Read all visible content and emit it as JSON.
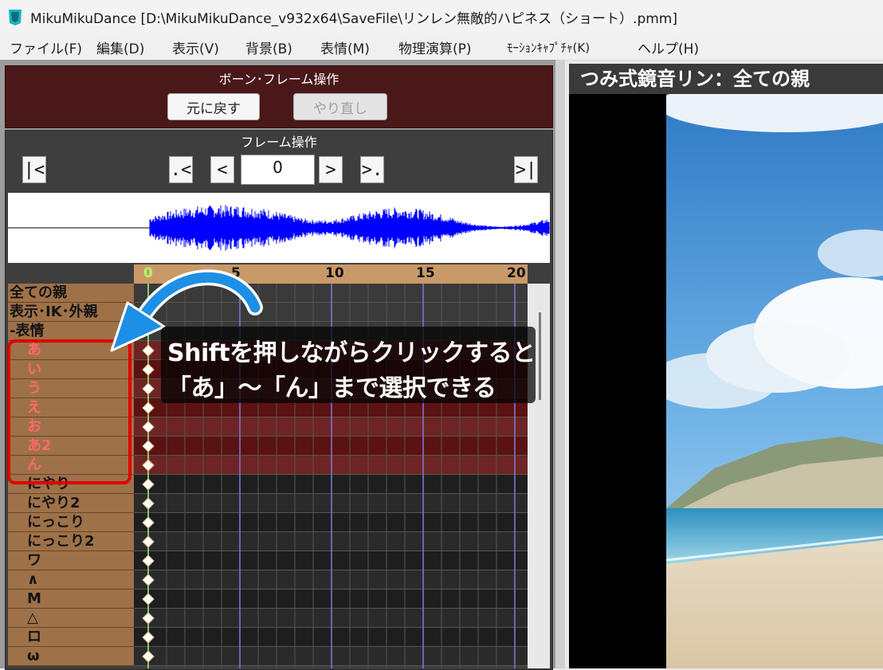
{
  "window": {
    "title": "MikuMikuDance [D:\\MikuMikuDance_v932x64\\SaveFile\\リンレン無敵的ハピネス（ショート）.pmm]"
  },
  "menu": [
    "ファイル(F)",
    "編集(D)",
    "表示(V)",
    "背景(B)",
    "表情(M)",
    "物理演算(P)",
    "ﾓｰｼｮﾝｷｬﾌﾟﾁｬ(K)",
    "ヘルプ(H)"
  ],
  "bone_frame": {
    "title": "ボーン･フレーム操作",
    "undo": "元に戻す",
    "redo": "やり直し"
  },
  "frame_ops": {
    "title": "フレーム操作",
    "first": "|<",
    "prev_key": ".<",
    "prev": "<",
    "frame_value": "0",
    "next": ">",
    "next_key": ">.",
    "last": ">|"
  },
  "timeline": {
    "ticks": [
      "0",
      "5",
      "10",
      "15",
      "20"
    ],
    "rows": [
      {
        "label": "全ての親",
        "kind": "group"
      },
      {
        "label": "表示･IK･外親",
        "kind": "group"
      },
      {
        "label": "-表情",
        "kind": "group"
      },
      {
        "label": "あ",
        "kind": "morph"
      },
      {
        "label": "い",
        "kind": "morph"
      },
      {
        "label": "う",
        "kind": "morph"
      },
      {
        "label": "え",
        "kind": "morph"
      },
      {
        "label": "お",
        "kind": "morph"
      },
      {
        "label": "あ2",
        "kind": "morph"
      },
      {
        "label": "ん",
        "kind": "morph"
      },
      {
        "label": "にやり",
        "kind": "normal"
      },
      {
        "label": "にやり2",
        "kind": "normal"
      },
      {
        "label": "にっこり",
        "kind": "normal"
      },
      {
        "label": "にっこり2",
        "kind": "normal"
      },
      {
        "label": "ワ",
        "kind": "normal"
      },
      {
        "label": "∧",
        "kind": "normal"
      },
      {
        "label": "M",
        "kind": "normal"
      },
      {
        "label": "△",
        "kind": "normal"
      },
      {
        "label": "ロ",
        "kind": "normal"
      },
      {
        "label": "ω",
        "kind": "normal"
      }
    ]
  },
  "annotation": {
    "line1": "Shiftを押しながらクリックすると",
    "line2": "「あ」～「ん」まで選択できる"
  },
  "view": {
    "title": "つみ式鏡音リン：全ての親"
  },
  "colors": {
    "highlight": "#e00000",
    "morph_text": "#ff6a6a",
    "wave": "#0000ff",
    "arrow": "#1e8fe6",
    "selected_row": "#5a1212"
  }
}
